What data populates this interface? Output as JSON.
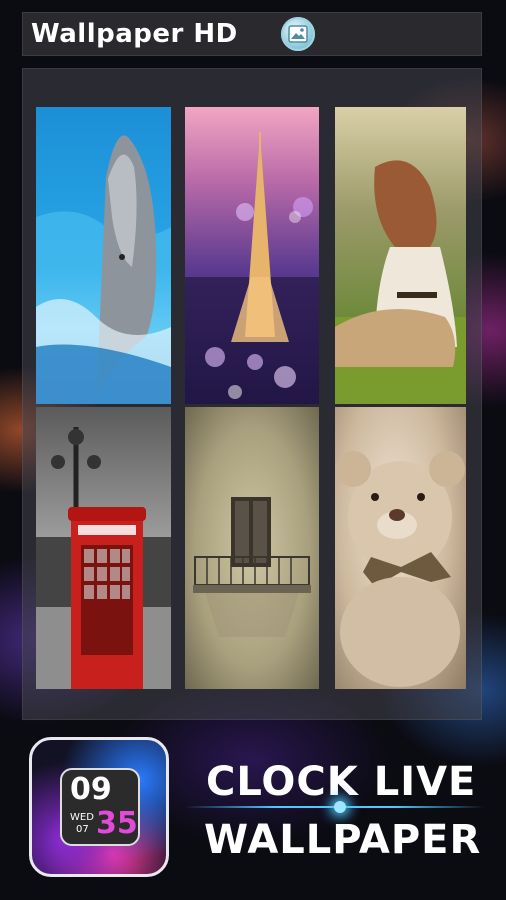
{
  "header": {
    "title": "Wallpaper HD",
    "app_icon": "image-icon"
  },
  "gallery": {
    "items": [
      {
        "subject": "dolphin"
      },
      {
        "subject": "eiffel-tower"
      },
      {
        "subject": "girl-on-grass"
      },
      {
        "subject": "phone-booth"
      },
      {
        "subject": "balcony"
      },
      {
        "subject": "teddy-bear"
      }
    ]
  },
  "promo": {
    "clock_hours": "09",
    "clock_minutes": "35",
    "clock_day": "WED",
    "clock_date": "07",
    "title_line1": "CLOCK LIVE",
    "title_line2": "WALLPAPER"
  },
  "colors": {
    "accent": "#4ec9ff",
    "minutes": "#e24ad8"
  }
}
